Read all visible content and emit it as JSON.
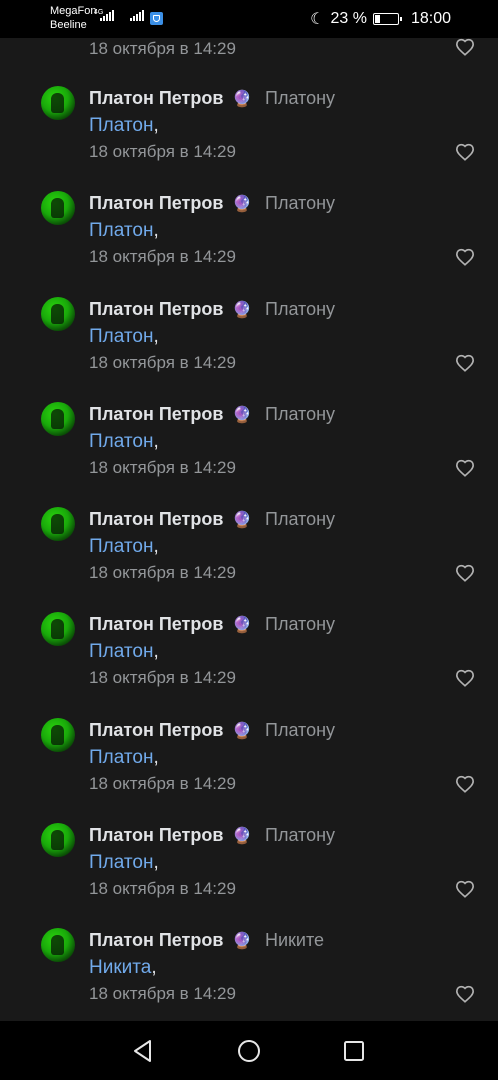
{
  "status_bar": {
    "carrier_1": "MegaFon",
    "carrier_2": "Beeline",
    "network_label": "4G",
    "battery": "23 %",
    "battery_level": 0.23,
    "time": "18:00"
  },
  "partial_top_time": "18 октября в 14:29",
  "comments": [
    {
      "author": "Платон Петров",
      "emoji": "🔮",
      "reply_to": "Платону",
      "mention": "Платон",
      "punct": ",",
      "time": "18 октября в 14:29"
    },
    {
      "author": "Платон Петров",
      "emoji": "🔮",
      "reply_to": "Платону",
      "mention": "Платон",
      "punct": ",",
      "time": "18 октября в 14:29"
    },
    {
      "author": "Платон Петров",
      "emoji": "🔮",
      "reply_to": "Платону",
      "mention": "Платон",
      "punct": ",",
      "time": "18 октября в 14:29"
    },
    {
      "author": "Платон Петров",
      "emoji": "🔮",
      "reply_to": "Платону",
      "mention": "Платон",
      "punct": ",",
      "time": "18 октября в 14:29"
    },
    {
      "author": "Платон Петров",
      "emoji": "🔮",
      "reply_to": "Платону",
      "mention": "Платон",
      "punct": ",",
      "time": "18 октября в 14:29"
    },
    {
      "author": "Платон Петров",
      "emoji": "🔮",
      "reply_to": "Платону",
      "mention": "Платон",
      "punct": ",",
      "time": "18 октября в 14:29"
    },
    {
      "author": "Платон Петров",
      "emoji": "🔮",
      "reply_to": "Платону",
      "mention": "Платон",
      "punct": ",",
      "time": "18 октября в 14:29"
    },
    {
      "author": "Платон Петров",
      "emoji": "🔮",
      "reply_to": "Платону",
      "mention": "Платон",
      "punct": ",",
      "time": "18 октября в 14:29"
    },
    {
      "author": "Платон Петров",
      "emoji": "🔮",
      "reply_to": "Никите",
      "mention": "Никита",
      "punct": ",",
      "time": "18 октября в 14:29"
    }
  ],
  "icons": {
    "like": "heart-outline-icon",
    "back": "triangle-back-icon",
    "home": "circle-home-icon",
    "recents": "square-recents-icon"
  },
  "colors": {
    "background": "#191919",
    "link": "#71aaeb",
    "secondary_text": "#939699",
    "avatar_green": "#19a80a"
  }
}
